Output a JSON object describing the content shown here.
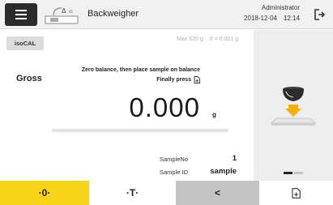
{
  "header": {
    "title": "Backweigher",
    "app_icon_text": "Δ",
    "app_icon_sub": "ID",
    "user": "Administrator",
    "date": "2018-12-04",
    "time": "12:14"
  },
  "main": {
    "isocal_label": "isoCAL",
    "max_capacity": "Max 620 g",
    "readability": "d = 0.001 g",
    "mode": "Gross",
    "instruction_line1": "Zero balance, then place sample on balance",
    "instruction_line2": "Finally press",
    "weight": "0.000",
    "unit": "g",
    "bargraph_level": 0,
    "sample_no_label": "SampleNo",
    "sample_no": "1",
    "sample_id_label": "Sample ID",
    "sample_id": "sample"
  },
  "side_panel": {
    "illustration": "sample-on-balance",
    "pages_total": 2,
    "page_active": 1
  },
  "bottom_bar": {
    "zero_label": "·0·",
    "tare_label": "·T·",
    "back_label": "<",
    "add_label": "add-icon"
  },
  "colors": {
    "zero_key": "#f7d417",
    "back_key": "#c4c4c4",
    "header_bg": "#f1f1f1",
    "side_panel_bg": "#eeeeee",
    "illustration_arrow": "#f5b000"
  }
}
